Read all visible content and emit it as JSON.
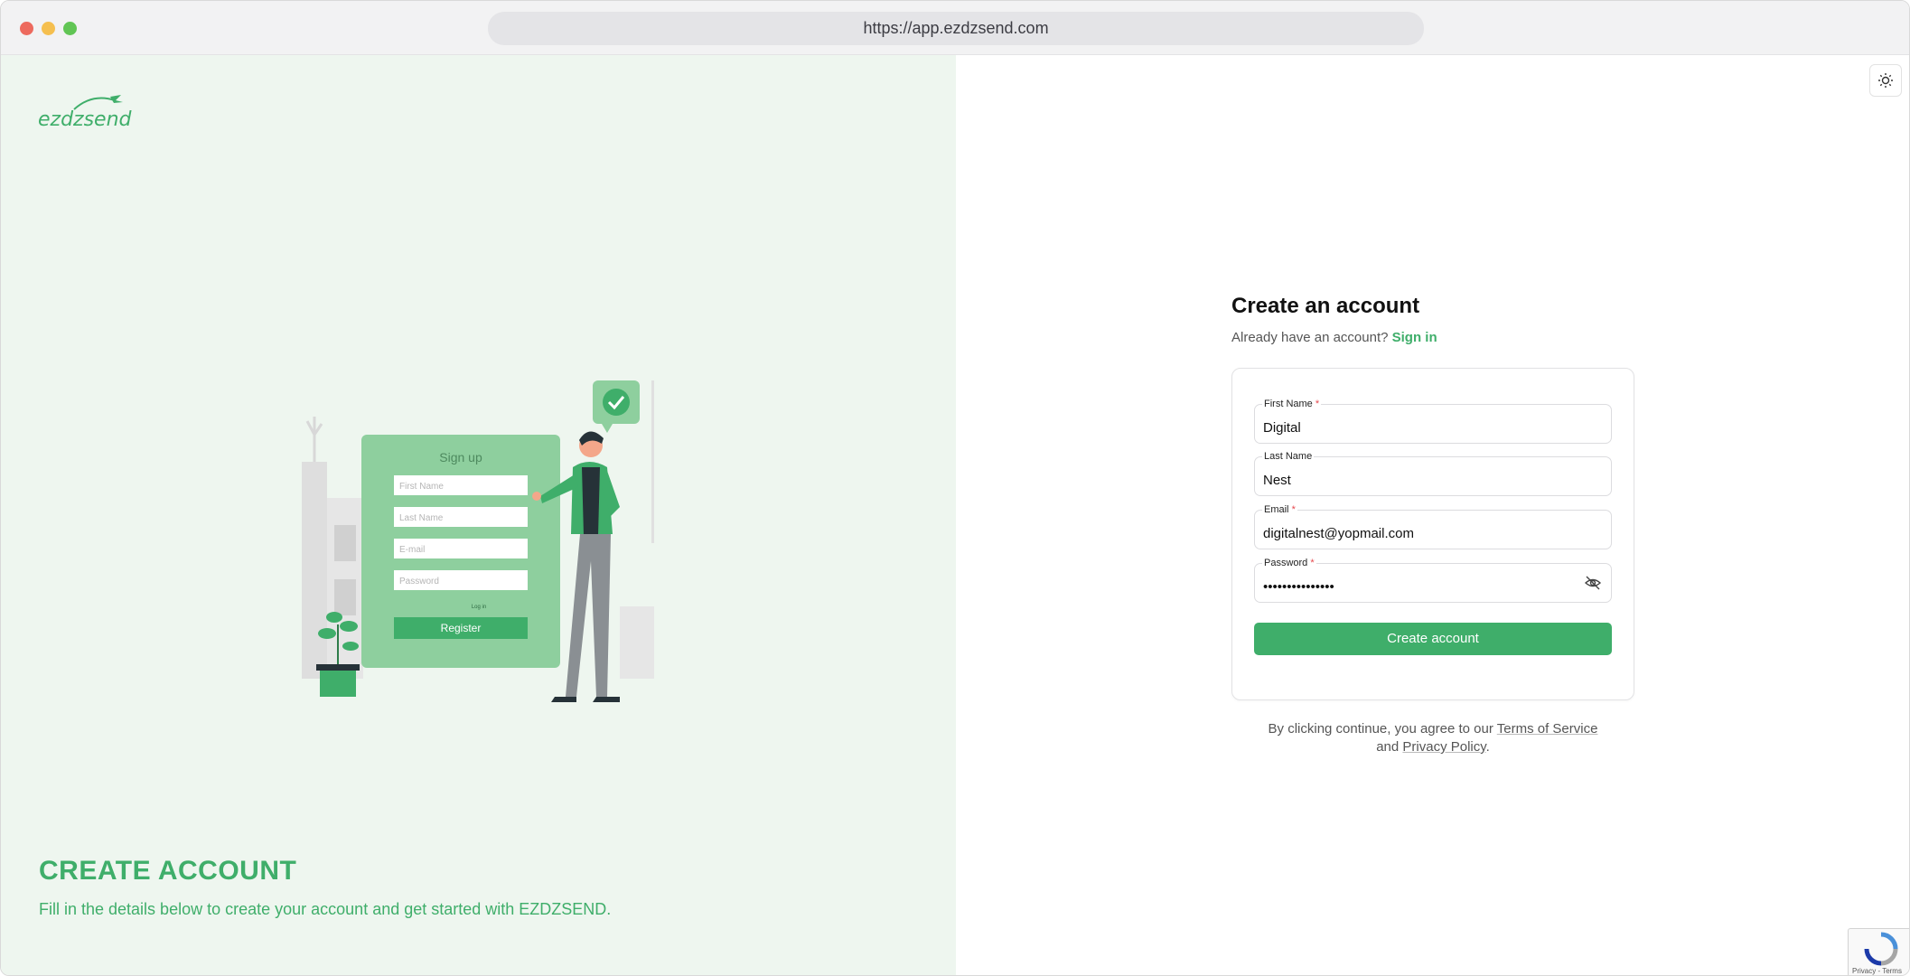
{
  "browser": {
    "url": "https://app.ezdzsend.com"
  },
  "brand": {
    "logo_text": "ezdzsend",
    "accent_color": "#3fae6a"
  },
  "left_panel": {
    "title": "CREATE ACCOUNT",
    "subtitle": "Fill in the details below to create your account and get started with EZDZSEND.",
    "illustration": {
      "heading": "Sign up",
      "first_name_placeholder": "First Name",
      "last_name_placeholder": "Last Name",
      "email_placeholder": "E-mail",
      "password_placeholder": "Password",
      "login_link": "Log in",
      "register_label": "Register"
    }
  },
  "form": {
    "title": "Create an account",
    "signin_prompt": "Already have an account?",
    "signin_link": "Sign in",
    "first_name": {
      "label": "First Name",
      "required": "*",
      "value": "Digital"
    },
    "last_name": {
      "label": "Last Name",
      "value": "Nest"
    },
    "email": {
      "label": "Email",
      "required": "*",
      "value": "digitalnest@yopmail.com"
    },
    "password": {
      "label": "Password",
      "required": "*",
      "value": "•••••••••••••••"
    },
    "submit_label": "Create account",
    "terms_prefix": "By clicking continue, you agree to our",
    "terms_link": "Terms of Service",
    "terms_and": "and",
    "privacy_link": "Privacy Policy",
    "terms_end": "."
  },
  "recaptcha": {
    "text": "Privacy - Terms"
  }
}
